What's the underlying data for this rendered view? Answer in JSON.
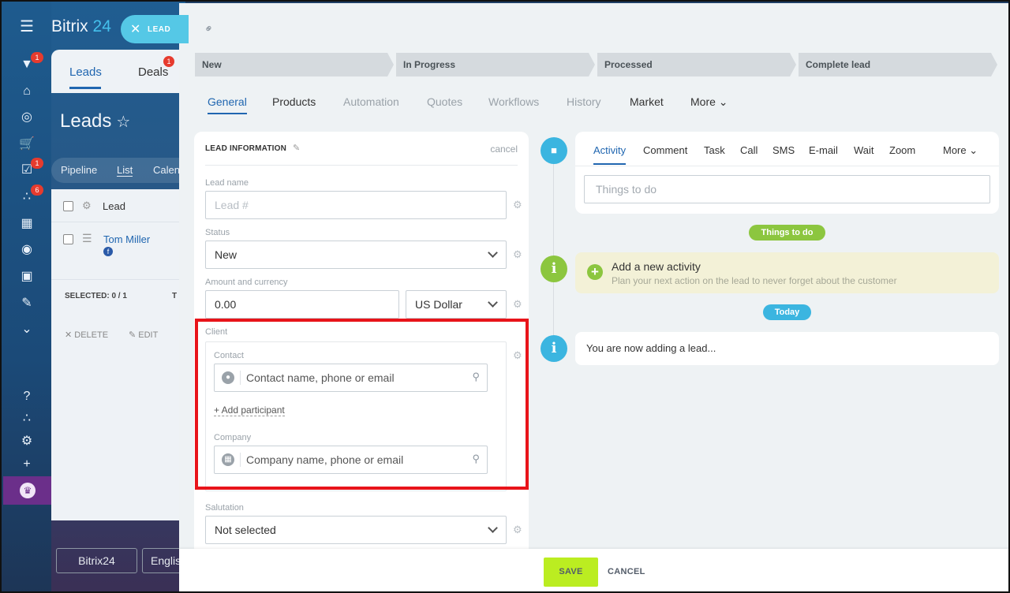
{
  "app": {
    "brand_name": "Bitrix",
    "brand_suffix": "24",
    "tab_leads": "Leads",
    "tab_deals": "Deals",
    "deals_badge": "1",
    "page_title": "Leads",
    "view_pipeline": "Pipeline",
    "view_list": "List",
    "view_calendar": "Calen",
    "column_lead": "Lead",
    "lead_row_name": "Tom Miller",
    "selected_label": "SELECTED: 0 / 1",
    "selected_extra": "T",
    "delete_label": "DELETE",
    "edit_label": "EDIT",
    "footer_brand": "Bitrix24",
    "footer_lang": "Englis",
    "sidebar_badges": [
      "1",
      "1",
      "6"
    ]
  },
  "slider": {
    "close_label": "LEAD",
    "stages": [
      "New",
      "In Progress",
      "Processed",
      "Complete lead"
    ],
    "tabs": [
      "General",
      "Products",
      "Automation",
      "Quotes",
      "Workflows",
      "History",
      "Market",
      "More"
    ],
    "section_title": "LEAD INFORMATION",
    "cancel_link": "cancel",
    "fields": {
      "lead_name_label": "Lead name",
      "lead_name_placeholder": "Lead #",
      "status_label": "Status",
      "status_value": "New",
      "amount_label": "Amount and currency",
      "amount_value": "0.00",
      "currency_value": "US Dollar",
      "client_label": "Client",
      "contact_label": "Contact",
      "contact_placeholder": "Contact name, phone or email",
      "add_participant": "+ Add participant",
      "company_label": "Company",
      "company_placeholder": "Company name, phone or email",
      "salutation_label": "Salutation",
      "salutation_value": "Not selected"
    },
    "activity_tabs": [
      "Activity",
      "Comment",
      "Task",
      "Call",
      "SMS",
      "E-mail",
      "Wait",
      "Zoom",
      "More"
    ],
    "things_to_do_placeholder": "Things to do",
    "things_to_do_pill": "Things to do",
    "add_activity_title": "Add a new activity",
    "add_activity_sub": "Plan your next action on the lead to never forget about the customer",
    "today_pill": "Today",
    "now_adding": "You are now adding a lead...",
    "save_label": "SAVE",
    "cancel_label": "CANCEL"
  },
  "colors": {
    "accent_blue": "#2066b0",
    "save_green": "#bbed21",
    "pill_green": "#8cc63f",
    "pill_blue": "#3bb5e0",
    "highlight_red": "#e8141a"
  }
}
